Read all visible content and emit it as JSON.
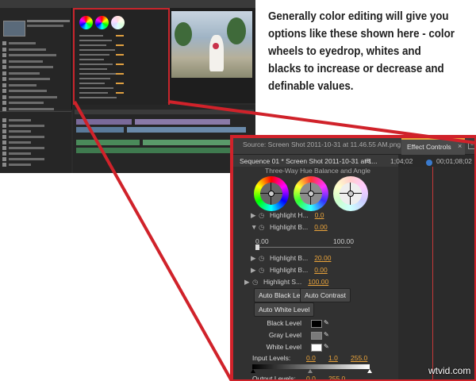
{
  "caption": "Generally color editing will give you options like these shown here - color wheels to eyedrop, whites and blacks to increase or decrease and definable values.",
  "colors": {
    "callout_red": "#d0222a",
    "panel_bg": "#313131",
    "value_orange": "#e9a33b",
    "active_tab_accent": "#e8a43a",
    "playhead_blue": "#3a7acc"
  },
  "panel": {
    "source_tab": "Source: Screen Shot 2011-10-31 at 11.46.55 AM.png",
    "effect_tab": "Effect Controls",
    "effect_tab_close": "×",
    "panel_menu_icon": "panel-menu-icon",
    "sequence_label": "Sequence 01 * Screen Shot 2011-10-31 at 1...",
    "timecode_start": "1;04;02",
    "timecode_end": "00;01;08;02",
    "partial_effect_title": "Three-Way Hue Balance and Angle",
    "wheels": [
      "shadows-wheel",
      "midtones-wheel",
      "highlights-wheel"
    ],
    "params": [
      {
        "label": "Highlight H...",
        "value": "0.0",
        "expanded": false
      },
      {
        "label": "Highlight B...",
        "value": "0.00",
        "expanded": true
      },
      {
        "label": "Highlight B...",
        "value": "20.00",
        "expanded": false
      },
      {
        "label": "Highlight B...",
        "value": "0.00",
        "expanded": false
      },
      {
        "label": "Highlight S...",
        "value": "100.00",
        "expanded": false
      }
    ],
    "range_min": "0.00",
    "range_max": "100.00",
    "slider_fraction": 0.0,
    "buttons": {
      "auto_black": "Auto Black Level",
      "auto_contrast": "Auto Contrast",
      "auto_white": "Auto White Level"
    },
    "levels": [
      {
        "label": "Black Level",
        "color": "#000000"
      },
      {
        "label": "Gray Level",
        "color": "#7a7a7a"
      },
      {
        "label": "White Level",
        "color": "#ffffff"
      }
    ],
    "input_levels_label": "Input Levels:",
    "input_levels_values": [
      "0.0",
      "1.0",
      "255.0"
    ],
    "output_levels_label": "Output Levels:",
    "output_levels_values": [
      "0.0",
      "255.0"
    ]
  },
  "watermark": "wtvid.com"
}
